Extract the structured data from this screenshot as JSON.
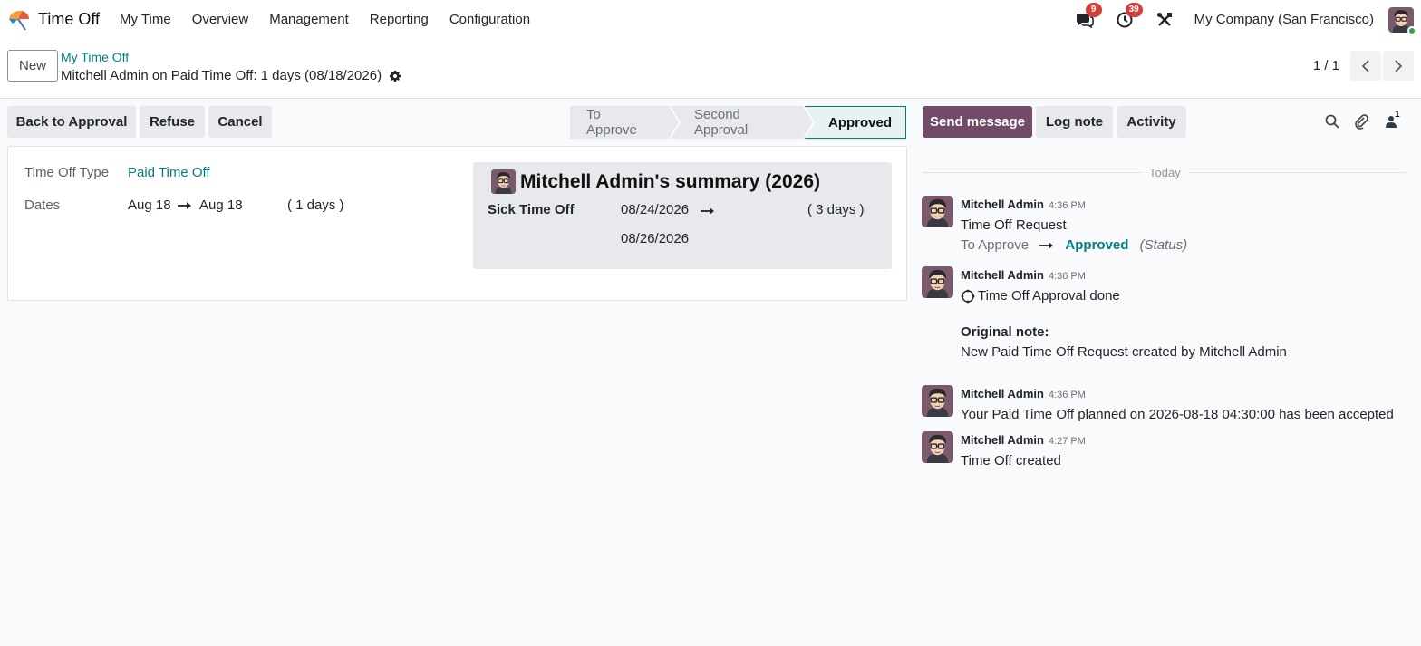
{
  "navbar": {
    "app_name": "Time Off",
    "menu": [
      "My Time",
      "Overview",
      "Management",
      "Reporting",
      "Configuration"
    ],
    "messages_badge": "9",
    "activities_badge": "39",
    "company": "My Company (San Francisco)"
  },
  "control_panel": {
    "new_label": "New",
    "breadcrumb": "My Time Off",
    "record_title": "Mitchell Admin on Paid Time Off: 1 days (08/18/2026)",
    "pager": "1 / 1"
  },
  "actions": {
    "back_to_approval": "Back to Approval",
    "refuse": "Refuse",
    "cancel": "Cancel"
  },
  "statusbar": {
    "stages": [
      "To Approve",
      "Second Approval",
      "Approved"
    ],
    "active": "Approved"
  },
  "form": {
    "type_label": "Time Off Type",
    "type_value": "Paid Time Off",
    "dates_label": "Dates",
    "date_from": "Aug 18",
    "date_to": "Aug 18",
    "duration": "( 1 days )",
    "summary": {
      "title": "Mitchell Admin's summary (2026)",
      "rows": [
        {
          "type": "Sick Time Off",
          "from": "08/24/2026",
          "to": "08/26/2026",
          "duration": "( 3 days )"
        }
      ]
    }
  },
  "chatter": {
    "send_message": "Send message",
    "log_note": "Log note",
    "activity": "Activity",
    "followers_count": "1",
    "date_separator": "Today",
    "messages": [
      {
        "author": "Mitchell Admin",
        "time": "4:36 PM",
        "body": "Time Off Request",
        "track_old": "To Approve",
        "track_new": "Approved",
        "track_field": "(Status)"
      },
      {
        "author": "Mitchell Admin",
        "time": "4:36 PM",
        "body": "Time Off Approval done",
        "note_label": "Original note:",
        "note_text": "New Paid Time Off Request created by Mitchell Admin"
      },
      {
        "author": "Mitchell Admin",
        "time": "4:36 PM",
        "body": "Your Paid Time Off planned on 2026-08-18 04:30:00 has been accepted"
      },
      {
        "author": "Mitchell Admin",
        "time": "4:27 PM",
        "body": "Time Off created"
      }
    ]
  },
  "colors": {
    "primary": "#714b67",
    "link": "#017e84",
    "badge": "#d23f3a",
    "button_bg": "#e7e9ed"
  },
  "icons": [
    "app-logo-icon",
    "chat-icon",
    "clock-icon",
    "tools-icon",
    "gear-icon",
    "chevron-left-icon",
    "chevron-right-icon",
    "search-icon",
    "paperclip-icon",
    "user-icon",
    "arrow-right-icon",
    "clock-spinner-icon"
  ]
}
